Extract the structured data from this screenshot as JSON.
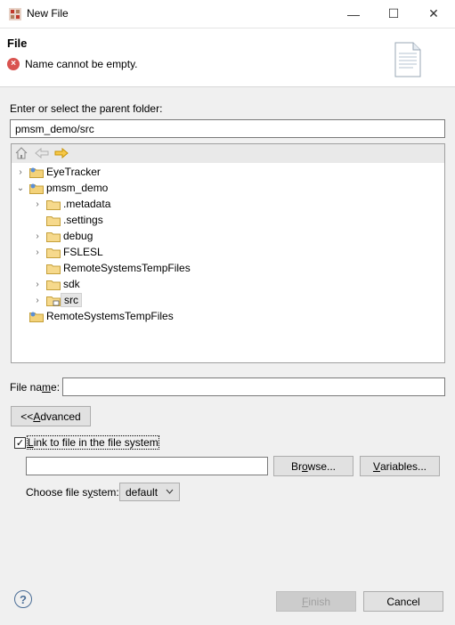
{
  "window": {
    "title": "New File",
    "minimize": "—",
    "maximize": "☐",
    "close": "✕"
  },
  "header": {
    "title": "File",
    "error": "Name cannot be empty."
  },
  "parent": {
    "label": "Enter or select the parent folder:",
    "value": "pmsm_demo/src"
  },
  "tree": {
    "items": [
      {
        "label": "EyeTracker",
        "expander": "›"
      },
      {
        "label": "pmsm_demo",
        "expander": "⌄"
      },
      {
        "label": ".metadata",
        "expander": "›"
      },
      {
        "label": ".settings",
        "expander": ""
      },
      {
        "label": "debug",
        "expander": "›"
      },
      {
        "label": "FSLESL",
        "expander": "›"
      },
      {
        "label": "RemoteSystemsTempFiles",
        "expander": ""
      },
      {
        "label": "sdk",
        "expander": "›"
      },
      {
        "label": "src",
        "expander": "›"
      },
      {
        "label": "RemoteSystemsTempFiles",
        "expander": ""
      }
    ]
  },
  "filename": {
    "label_pre": "File na",
    "label_u": "m",
    "label_post": "e:",
    "value": ""
  },
  "advanced": {
    "pre": "<< ",
    "u": "A",
    "post": "dvanced"
  },
  "link": {
    "checked": "✓",
    "u": "L",
    "post": "ink to file in the file system",
    "value": ""
  },
  "browse": {
    "pre": "Br",
    "u": "o",
    "post": "wse..."
  },
  "variables": {
    "u": "V",
    "post": "ariables..."
  },
  "filesystem": {
    "label_pre": "Choose file s",
    "label_u": "y",
    "label_post": "stem:",
    "value": "default"
  },
  "footer": {
    "help": "?",
    "finish": {
      "u": "F",
      "post": "inish"
    },
    "cancel": "Cancel"
  }
}
